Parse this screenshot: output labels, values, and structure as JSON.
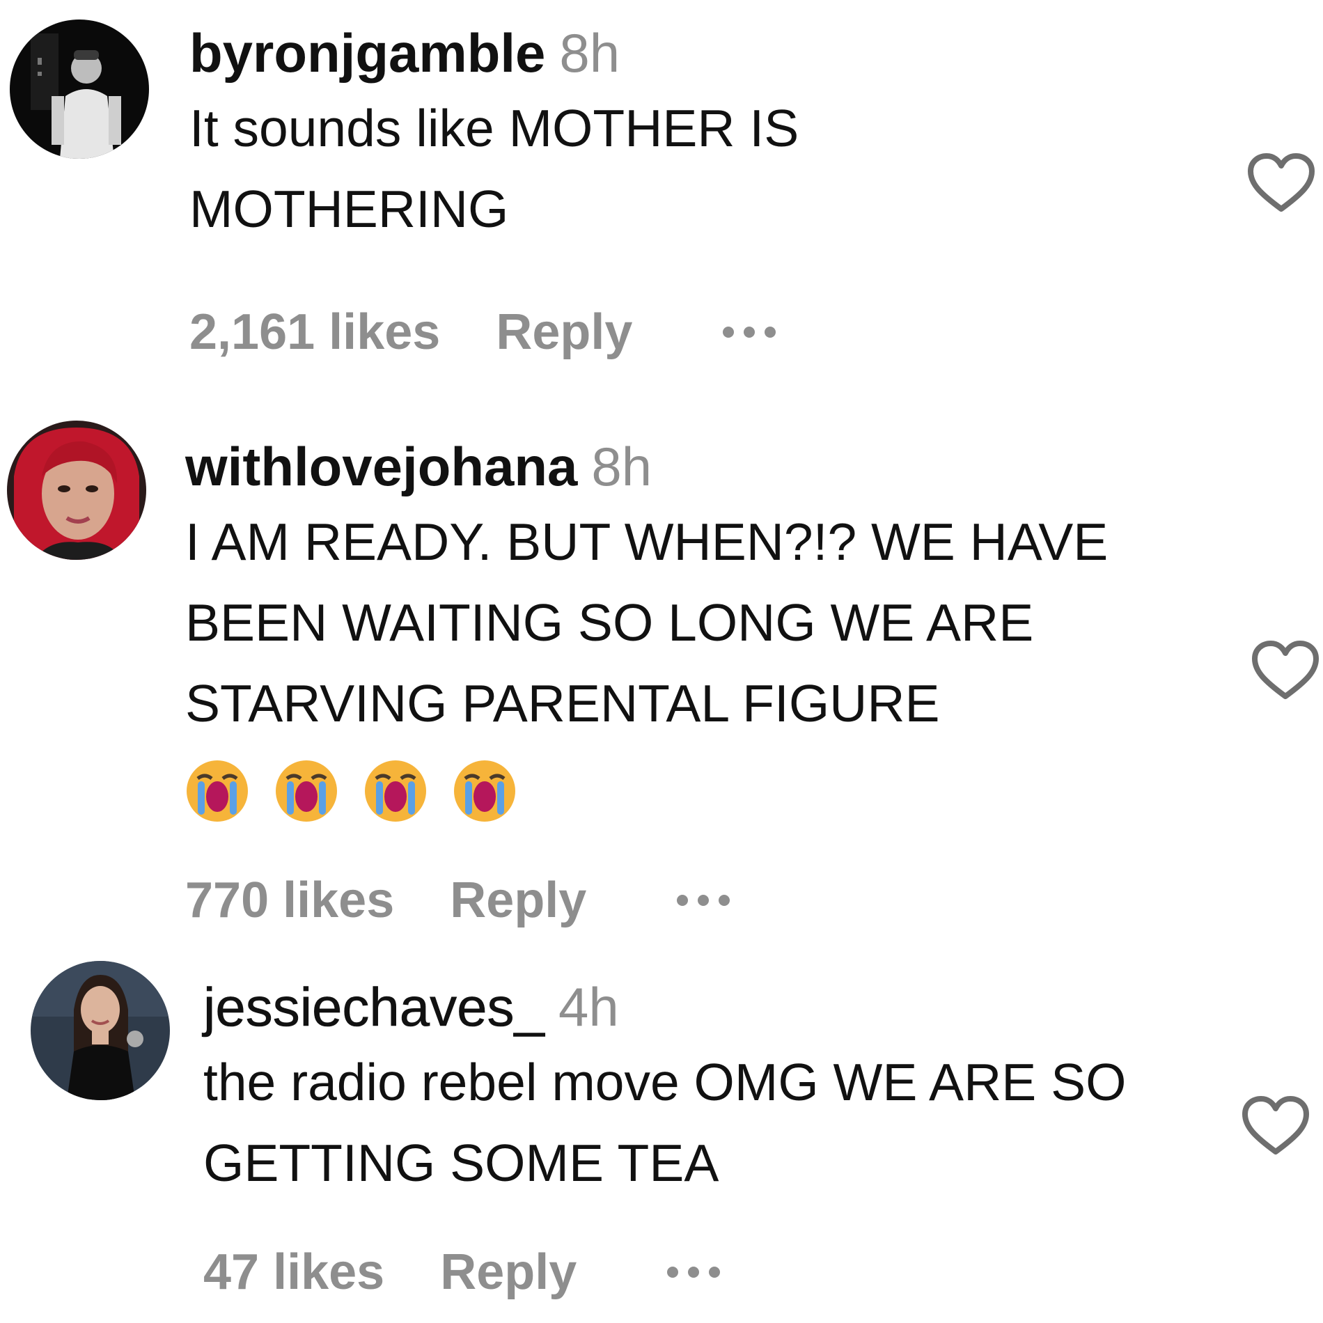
{
  "comments": [
    {
      "username": "byronjgamble",
      "time": "8h",
      "text": "It sounds like MOTHER IS MOTHERING",
      "likes": "2,161 likes",
      "reply": "Reply",
      "avatar": "black-and-white-photo-man"
    },
    {
      "username": "withlovejohana",
      "time": "8h",
      "text": "I AM READY. BUT WHEN?!? WE HAVE BEEN WAITING SO LONG WE ARE STARVING PARENTAL FIGURE",
      "emoji": [
        "loudly-crying-face",
        "loudly-crying-face",
        "loudly-crying-face",
        "loudly-crying-face"
      ],
      "likes": "770 likes",
      "reply": "Reply",
      "avatar": "red-hair-woman-photo"
    },
    {
      "username": "jessiechaves_",
      "time": "4h",
      "text": "the radio rebel move OMG WE ARE SO GETTING SOME TEA",
      "likes": "47 likes",
      "reply": "Reply",
      "avatar": "woman-black-dress-photo"
    }
  ],
  "colors": {
    "text": "#111111",
    "muted": "#8e8e8e",
    "heart_outline": "#6e6e6e"
  },
  "icons": {
    "like": "heart-outline-icon",
    "options": "more-options-icon"
  }
}
